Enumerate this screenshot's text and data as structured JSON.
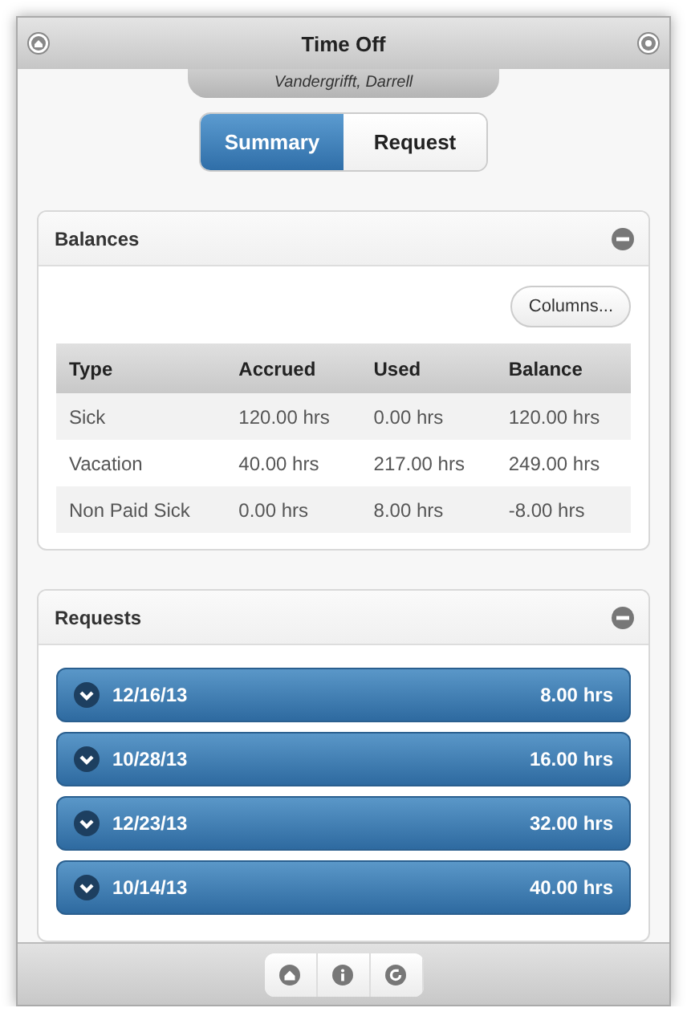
{
  "header": {
    "title": "Time Off",
    "subtitle": "Vandergrifft, Darrell"
  },
  "tabs": [
    {
      "label": "Summary",
      "selected": true
    },
    {
      "label": "Request",
      "selected": false
    }
  ],
  "balances": {
    "title": "Balances",
    "expanded": true,
    "columns_button": "Columns...",
    "table": {
      "columns": [
        "Type",
        "Accrued",
        "Used",
        "Balance"
      ],
      "rows": [
        [
          "Sick",
          "120.00 hrs",
          "0.00 hrs",
          "120.00 hrs"
        ],
        [
          "Vacation",
          "40.00 hrs",
          "217.00 hrs",
          "249.00 hrs"
        ],
        [
          "Non Paid Sick",
          "0.00 hrs",
          "8.00 hrs",
          "-8.00 hrs"
        ]
      ]
    }
  },
  "requests": {
    "title": "Requests",
    "expanded": true,
    "items": [
      {
        "date": "12/16/13",
        "hours": "8.00 hrs",
        "expanded": false
      },
      {
        "date": "10/28/13",
        "hours": "16.00 hrs",
        "expanded": false
      },
      {
        "date": "12/23/13",
        "hours": "32.00 hrs",
        "expanded": false
      },
      {
        "date": "10/14/13",
        "hours": "40.00 hrs",
        "expanded": false
      }
    ]
  },
  "footer": {
    "buttons": [
      {
        "kind": "home"
      },
      {
        "kind": "info"
      },
      {
        "kind": "refresh"
      }
    ]
  }
}
